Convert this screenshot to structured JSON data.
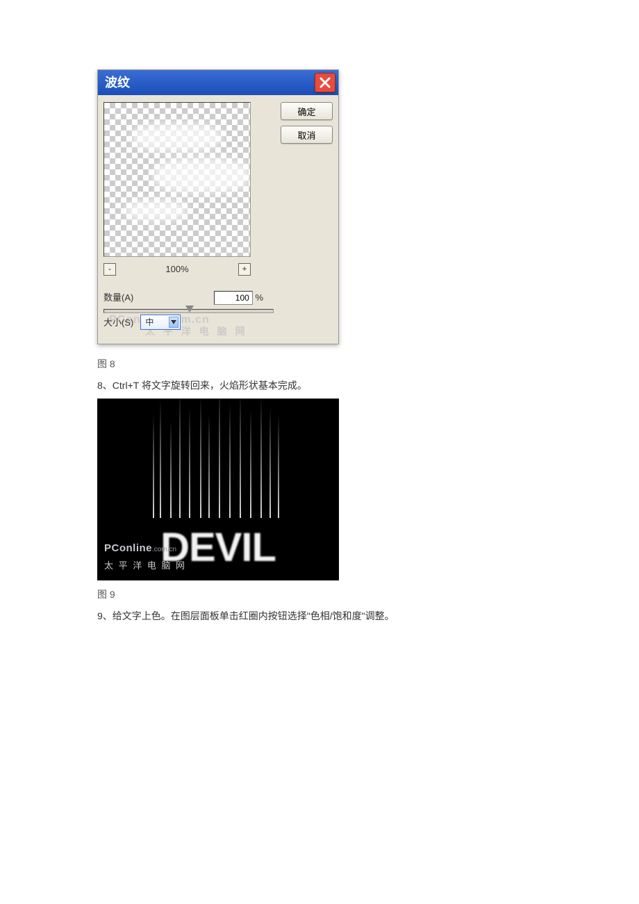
{
  "dialog": {
    "title": "波纹",
    "buttons": {
      "ok": "确定",
      "cancel": "取消"
    },
    "zoom": {
      "level": "100%",
      "minus": "-",
      "plus": "+"
    },
    "amount": {
      "label": "数量(A)",
      "value": "100",
      "unit": "%"
    },
    "size": {
      "label": "大小(S)",
      "selected": "中"
    },
    "watermark": {
      "line1": "PConline.com.cn",
      "line2": "太 平 洋 电 脑 网"
    }
  },
  "captions": {
    "fig8": "图 8",
    "fig9": "图 9"
  },
  "text": {
    "step8": "8、Ctrl+T 将文字旋转回来，火焰形状基本完成。",
    "step9": "9、给文字上色。在图层面板单击红圈内按钮选择\"色相/饱和度\"调整。"
  },
  "result": {
    "word": "DEVIL",
    "watermark": {
      "brand": "PConline",
      "suffix": ".com.cn",
      "cn": "太 平 洋 电 脑 网"
    }
  }
}
